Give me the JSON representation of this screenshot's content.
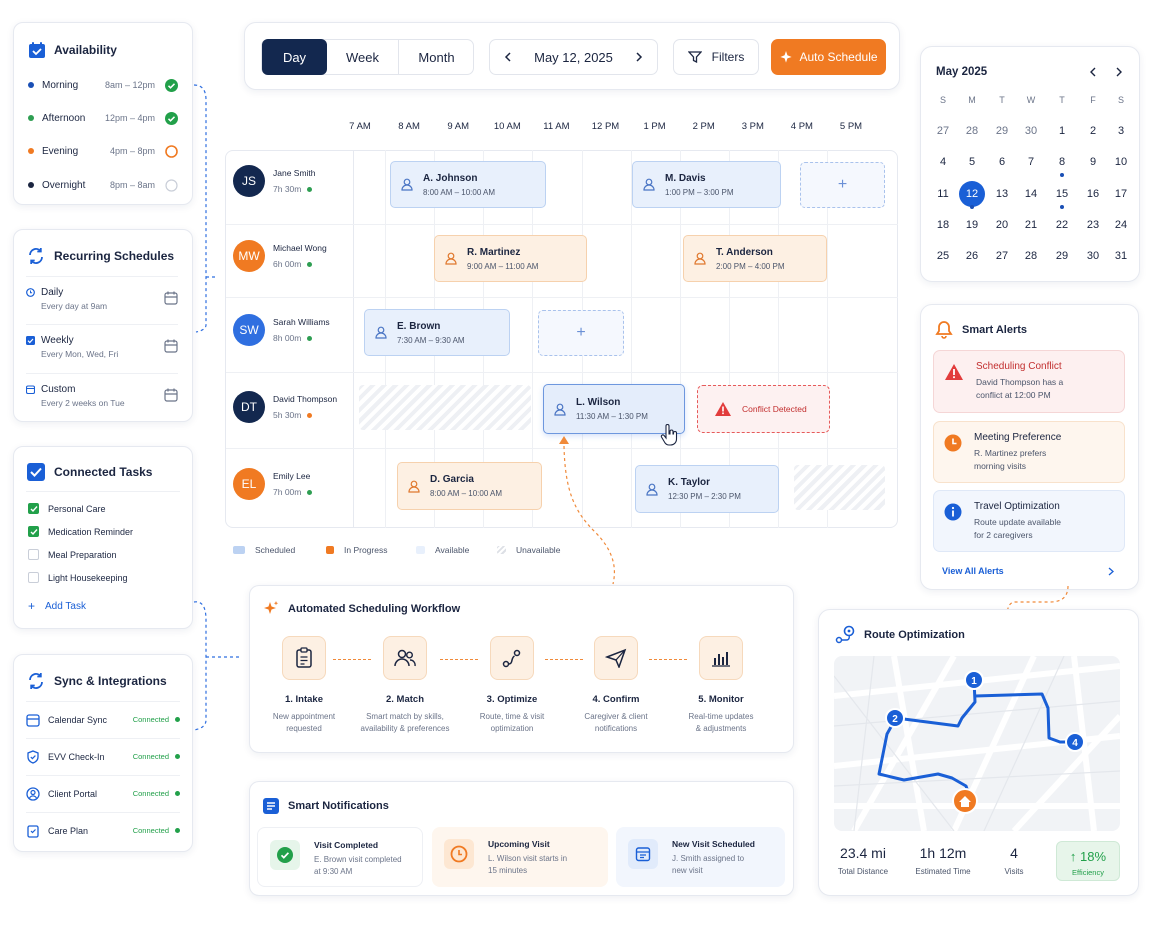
{
  "availability": {
    "title": "Availability",
    "items": [
      {
        "label": "Morning",
        "time": "8am – 12pm",
        "color": "#1a4fb5",
        "state": "checked"
      },
      {
        "label": "Afternoon",
        "time": "12pm – 4pm",
        "color": "#2e9e52",
        "state": "checked"
      },
      {
        "label": "Evening",
        "time": "4pm – 8pm",
        "color": "#f07a22",
        "state": "partial"
      },
      {
        "label": "Overnight",
        "time": "8pm – 8am",
        "color": "#1b2540",
        "state": "empty"
      }
    ]
  },
  "recurring": {
    "title": "Recurring Schedules",
    "items": [
      {
        "label": "Daily",
        "sub": "Every day at 9am"
      },
      {
        "label": "Weekly",
        "sub": "Every Mon, Wed, Fri"
      },
      {
        "label": "Custom",
        "sub": "Every 2 weeks on Tue"
      }
    ]
  },
  "tasks": {
    "title": "Connected Tasks",
    "items": [
      {
        "label": "Personal Care",
        "checked": true
      },
      {
        "label": "Medication Reminder",
        "checked": true
      },
      {
        "label": "Meal Preparation",
        "checked": false
      },
      {
        "label": "Light Housekeeping",
        "checked": false
      }
    ],
    "add_label": "Add Task"
  },
  "sync": {
    "title": "Sync & Integrations",
    "items": [
      {
        "label": "Calendar Sync",
        "status": "Connected"
      },
      {
        "label": "EVV Check-In",
        "status": "Connected"
      },
      {
        "label": "Client Portal",
        "status": "Connected"
      },
      {
        "label": "Care Plan",
        "status": "Connected"
      }
    ]
  },
  "toolbar": {
    "views": [
      "Day",
      "Week",
      "Month"
    ],
    "active_view": "Day",
    "date": "May 12, 2025",
    "filters_label": "Filters",
    "auto_label": "Auto Schedule"
  },
  "schedule": {
    "hours": [
      "7 AM",
      "8 AM",
      "9 AM",
      "10 AM",
      "11 AM",
      "12 PM",
      "1 PM",
      "2 PM",
      "3 PM",
      "4 PM",
      "5 PM"
    ],
    "caregivers": [
      {
        "initials": "JS",
        "name": "Jane Smith",
        "hours": "7h 30m",
        "avatar_color": "#13284f",
        "status_color": "#2e9e52"
      },
      {
        "initials": "MW",
        "name": "Michael Wong",
        "hours": "6h 00m",
        "avatar_color": "#f07a22",
        "status_color": "#2e9e52"
      },
      {
        "initials": "SW",
        "name": "Sarah Williams",
        "hours": "8h 00m",
        "avatar_color": "#2f6fe0",
        "status_color": "#2e9e52"
      },
      {
        "initials": "DT",
        "name": "David Thompson",
        "hours": "5h 30m",
        "avatar_color": "#13284f",
        "status_color": "#f07a22"
      },
      {
        "initials": "EL",
        "name": "Emily Lee",
        "hours": "7h 00m",
        "avatar_color": "#f07a22",
        "status_color": "#2e9e52"
      }
    ],
    "visits": [
      {
        "client": "A. Johnson",
        "time": "8:00 AM – 10:00 AM",
        "status": "scheduled"
      },
      {
        "client": "M. Davis",
        "time": "1:00 PM – 3:00 PM",
        "status": "scheduled"
      },
      {
        "client": "R. Martinez",
        "time": "9:00 AM – 11:00 AM",
        "status": "in-progress"
      },
      {
        "client": "T. Anderson",
        "time": "2:00 PM – 4:00 PM",
        "status": "in-progress"
      },
      {
        "client": "E. Brown",
        "time": "7:30 AM – 9:30 AM",
        "status": "scheduled"
      },
      {
        "client": "L. Wilson",
        "time": "11:30 AM – 1:30 PM",
        "status": "scheduled"
      },
      {
        "client": "D. Garcia",
        "time": "8:00 AM – 10:00 AM",
        "status": "in-progress"
      },
      {
        "client": "K. Taylor",
        "time": "12:30 PM – 2:30 PM",
        "status": "scheduled"
      }
    ],
    "conflict_label": "Conflict Detected",
    "legend": [
      "Scheduled",
      "In Progress",
      "Available",
      "Unavailable"
    ]
  },
  "workflow": {
    "title": "Automated Scheduling Workflow",
    "steps": [
      {
        "title": "1. Intake",
        "l1": "New appointment",
        "l2": "requested"
      },
      {
        "title": "2. Match",
        "l1": "Smart match by skills,",
        "l2": "availability & preferences"
      },
      {
        "title": "3. Optimize",
        "l1": "Route, time & visit",
        "l2": "optimization"
      },
      {
        "title": "4. Confirm",
        "l1": "Caregiver & client",
        "l2": "notifications"
      },
      {
        "title": "5. Monitor",
        "l1": "Real-time updates",
        "l2": "& adjustments"
      }
    ]
  },
  "notifications": {
    "title": "Smart Notifications",
    "items": [
      {
        "title": "Visit Completed",
        "l1": "E. Brown visit completed",
        "l2": "at 9:30 AM"
      },
      {
        "title": "Upcoming Visit",
        "l1": "L. Wilson visit starts in",
        "l2": "15 minutes"
      },
      {
        "title": "New Visit Scheduled",
        "l1": "J. Smith assigned to",
        "l2": "new visit"
      }
    ]
  },
  "calendar": {
    "month": "May 2025",
    "dow": [
      "S",
      "M",
      "T",
      "W",
      "T",
      "F",
      "S"
    ],
    "weeks": [
      [
        "27",
        "28",
        "29",
        "30",
        "1",
        "2",
        "3"
      ],
      [
        "4",
        "5",
        "6",
        "7",
        "8",
        "9",
        "10"
      ],
      [
        "11",
        "12",
        "13",
        "14",
        "15",
        "16",
        "17"
      ],
      [
        "18",
        "19",
        "20",
        "21",
        "22",
        "23",
        "24"
      ],
      [
        "25",
        "26",
        "27",
        "28",
        "29",
        "30",
        "31"
      ]
    ],
    "selected": "12",
    "accent": "#1a5fd6"
  },
  "alerts": {
    "title": "Smart Alerts",
    "items": [
      {
        "title": "Scheduling Conflict",
        "l1": "David Thompson has a",
        "l2": "conflict at 12:00 PM"
      },
      {
        "title": "Meeting Preference",
        "l1": "R. Martinez prefers",
        "l2": "morning visits"
      },
      {
        "title": "Travel Optimization",
        "l1": "Route update available",
        "l2": "for 2 caregivers"
      }
    ],
    "view_all": "View All Alerts"
  },
  "route": {
    "title": "Route Optimization",
    "stops": [
      "1",
      "2",
      "4"
    ],
    "stats": [
      {
        "value": "23.4 mi",
        "label": "Total Distance"
      },
      {
        "value": "1h 12m",
        "label": "Estimated Time"
      },
      {
        "value": "4",
        "label": "Visits"
      }
    ],
    "efficiency": {
      "value": "↑ 18%",
      "label": "Efficiency"
    }
  }
}
